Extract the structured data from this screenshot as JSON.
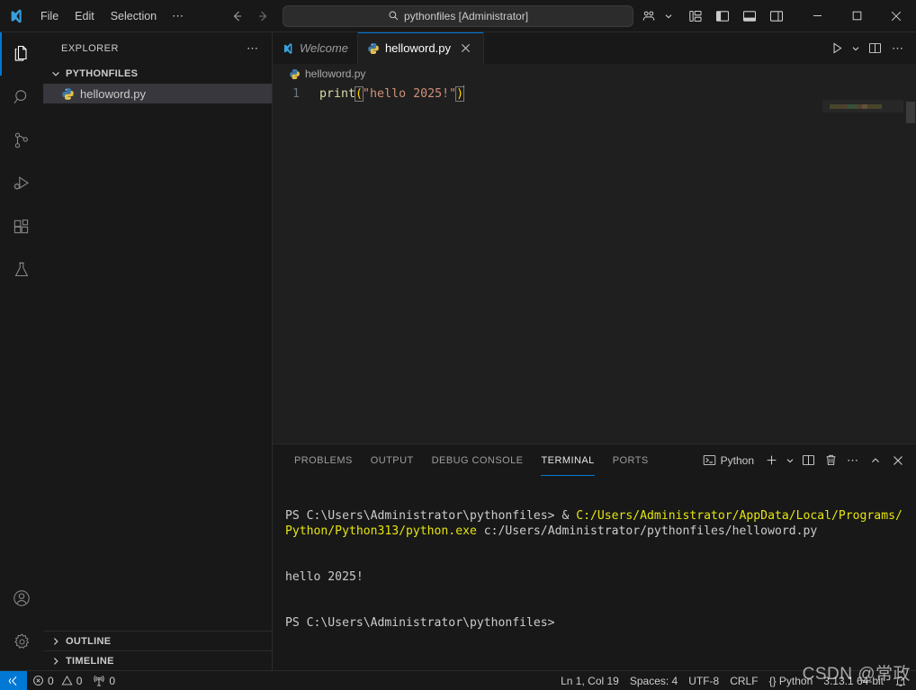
{
  "titlebar": {
    "logo_icon": "vscode-logo-icon",
    "menus": [
      {
        "label": "File",
        "name": "menu-file"
      },
      {
        "label": "Edit",
        "name": "menu-edit"
      },
      {
        "label": "Selection",
        "name": "menu-selection"
      }
    ],
    "menu_overflow": "⋯",
    "nav_back_icon": "arrow-left-icon",
    "nav_forward_icon": "arrow-right-icon",
    "search": {
      "icon": "search-icon",
      "value": "pythonfiles [Administrator]",
      "placeholder": "Search"
    },
    "right_icons": [
      {
        "name": "remote-explorer-icon",
        "label": ""
      },
      {
        "name": "chevron-down-icon",
        "label": ""
      },
      {
        "name": "customize-layout-icon",
        "label": ""
      },
      {
        "name": "toggle-primary-sidebar-icon",
        "label": ""
      },
      {
        "name": "toggle-panel-icon",
        "label": ""
      },
      {
        "name": "toggle-secondary-sidebar-icon",
        "label": ""
      }
    ],
    "window_controls": {
      "minimize": "minimize-icon",
      "maximize": "maximize-icon",
      "close": "close-icon"
    }
  },
  "activitybar": {
    "items": [
      {
        "name": "activitybar-explorer",
        "icon": "files-icon",
        "active": true
      },
      {
        "name": "activitybar-search",
        "icon": "search-icon",
        "active": false
      },
      {
        "name": "activitybar-source-control",
        "icon": "source-control-icon",
        "active": false
      },
      {
        "name": "activitybar-run-debug",
        "icon": "run-debug-icon",
        "active": false
      },
      {
        "name": "activitybar-extensions",
        "icon": "extensions-icon",
        "active": false
      },
      {
        "name": "activitybar-testing",
        "icon": "beaker-icon",
        "active": false
      }
    ],
    "bottom": [
      {
        "name": "activitybar-accounts",
        "icon": "account-icon"
      },
      {
        "name": "activitybar-settings",
        "icon": "gear-icon"
      }
    ]
  },
  "sidebar": {
    "title": "EXPLORER",
    "actions_icon": "ellipsis-icon",
    "folder": {
      "label": "PYTHONFILES",
      "expanded": true,
      "chevron": "chevron-down-icon"
    },
    "files": [
      {
        "label": "helloword.py",
        "icon": "python-file-icon",
        "selected": true
      }
    ],
    "collapsed_sections": [
      {
        "label": "OUTLINE",
        "chevron": "chevron-right-icon"
      },
      {
        "label": "TIMELINE",
        "chevron": "chevron-right-icon"
      }
    ]
  },
  "editor": {
    "tabs": [
      {
        "label": "Welcome",
        "icon": "vscode-logo-icon",
        "active": false,
        "closable": false
      },
      {
        "label": "helloword.py",
        "icon": "python-file-icon",
        "active": true,
        "closable": true,
        "close_icon": "close-icon"
      }
    ],
    "actions": [
      {
        "name": "run-python-file-button",
        "icon": "play-icon"
      },
      {
        "name": "run-options-chevron-icon",
        "icon": "chevron-down-icon"
      },
      {
        "name": "split-editor-right-button",
        "icon": "split-editor-icon"
      },
      {
        "name": "more-actions-button",
        "icon": "ellipsis-icon"
      }
    ],
    "breadcrumb": {
      "icon": "python-file-icon",
      "label": "helloword.py"
    },
    "code": {
      "line_number": "1",
      "indent": "  ",
      "func": "print",
      "open_paren": "(",
      "string": "\"hello 2025!\"",
      "close_paren": ")"
    }
  },
  "panel": {
    "tabs": [
      {
        "label": "PROBLEMS",
        "active": false
      },
      {
        "label": "OUTPUT",
        "active": false
      },
      {
        "label": "DEBUG CONSOLE",
        "active": false
      },
      {
        "label": "TERMINAL",
        "active": true
      },
      {
        "label": "PORTS",
        "active": false
      }
    ],
    "terminal_selector": {
      "icon": "terminal-powershell-icon",
      "label": "Python"
    },
    "actions": [
      {
        "name": "new-terminal-button",
        "icon": "plus-icon"
      },
      {
        "name": "terminal-profile-chevron-icon",
        "icon": "chevron-down-icon"
      },
      {
        "name": "split-terminal-button",
        "icon": "split-editor-icon"
      },
      {
        "name": "kill-terminal-button",
        "icon": "trash-icon"
      },
      {
        "name": "panel-more-actions-button",
        "icon": "ellipsis-icon"
      },
      {
        "name": "maximize-panel-button",
        "icon": "chevron-up-icon"
      },
      {
        "name": "close-panel-button",
        "icon": "close-icon"
      }
    ],
    "terminal_lines": [
      {
        "segments": [
          {
            "text": "PS C:\\Users\\Administrator\\pythonfiles> & ",
            "color": "white"
          },
          {
            "text": "C:/Users/Administrator/AppData/Local/Programs/Python/Python313/python.exe",
            "color": "yellow"
          },
          {
            "text": " c:/Users/Administrator/pythonfiles/helloword.py",
            "color": "white"
          }
        ]
      },
      {
        "segments": [
          {
            "text": "hello 2025!",
            "color": "white"
          }
        ]
      },
      {
        "segments": [
          {
            "text": "PS C:\\Users\\Administrator\\pythonfiles>",
            "color": "white"
          }
        ]
      }
    ]
  },
  "statusbar": {
    "remote": {
      "icon": "remote-indicator-icon",
      "label": ""
    },
    "left_items": [
      {
        "name": "status-errors",
        "icon": "error-icon",
        "label": "0"
      },
      {
        "name": "status-warnings",
        "icon": "warning-icon",
        "label": "0"
      },
      {
        "name": "status-ports",
        "icon": "radio-tower-icon",
        "label": "0"
      }
    ],
    "right_items": [
      {
        "name": "status-cursor-position",
        "label": "Ln 1, Col 19"
      },
      {
        "name": "status-indentation",
        "label": "Spaces: 4"
      },
      {
        "name": "status-encoding",
        "label": "UTF-8"
      },
      {
        "name": "status-eol",
        "label": "CRLF"
      },
      {
        "name": "status-language-mode",
        "label": "{} Python"
      },
      {
        "name": "status-python-interpreter",
        "label": "3.13.1 64-bit"
      }
    ],
    "bell_icon": "bell-icon"
  },
  "watermark": {
    "text": "CSDN @常政"
  },
  "colors": {
    "accent": "#0078d4",
    "titlebar_bg": "#181818",
    "editor_bg": "#1f1f1f",
    "sidebar_bg": "#181818",
    "selection_bg": "#37373d",
    "terminal_yellow": "#e5e510",
    "code_function": "#dcdcaa",
    "code_string": "#ce9178",
    "code_bracket": "#ffd700"
  }
}
